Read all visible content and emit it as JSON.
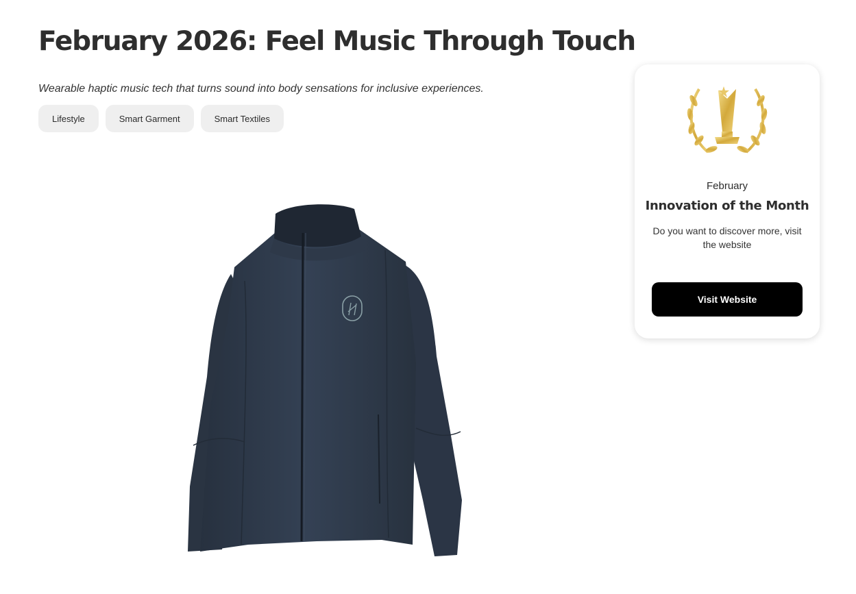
{
  "header": {
    "title": "February 2026: Feel Music Through Touch",
    "subtitle": "Wearable haptic music tech that turns sound into body sensations for inclusive experiences."
  },
  "tags": [
    "Lifestyle",
    "Smart Garment",
    "Smart Textiles"
  ],
  "product": {
    "image_icon": "jacket-image",
    "logo_icon": "haptic-logo-icon"
  },
  "award_card": {
    "icon": "trophy-laurel-icon",
    "month": "February",
    "title": "Innovation of the Month",
    "description": "Do you want to discover more, visit the website",
    "button_label": "Visit Website"
  },
  "colors": {
    "jacket": "#2f3b4c",
    "gold": "#d9b44a",
    "button_bg": "#000000",
    "tag_bg": "#efefef"
  }
}
